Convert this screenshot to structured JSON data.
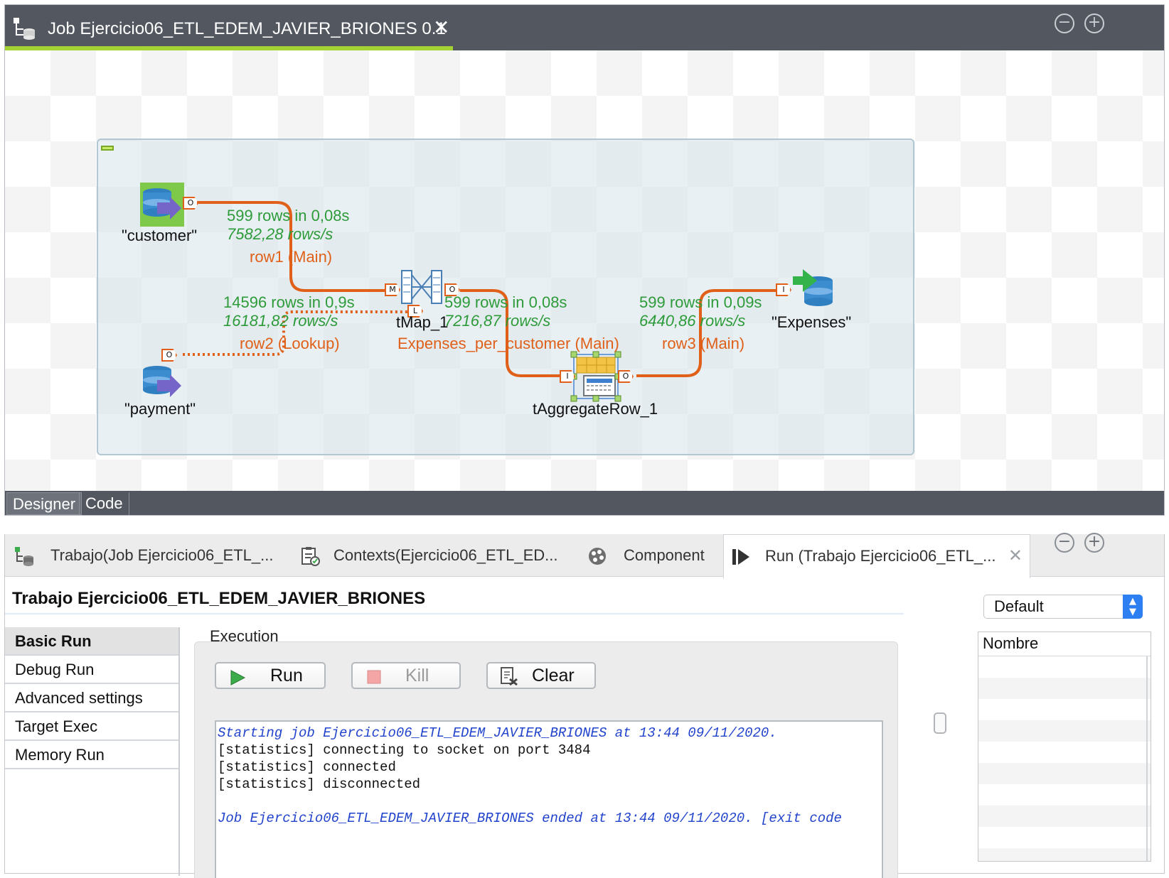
{
  "editor": {
    "tab_title": "Job Ejercicio06_ETL_EDEM_JAVIER_BRIONES 0.1",
    "tab_close": "✕",
    "minimize": "−",
    "maximize": "+",
    "bottom_tabs": [
      "Designer",
      "Code"
    ]
  },
  "components": {
    "customer": "\"customer\"",
    "payment": "\"payment\"",
    "tmap": "tMap_1",
    "aggregate": "tAggregateRow_1",
    "expenses": "\"Expenses\""
  },
  "ports": {
    "customer_out": "O",
    "payment_out": "O",
    "tmap_main_in": "M",
    "tmap_lookup_in": "L",
    "tmap_out": "O",
    "agg_in": "I",
    "agg_out": "O",
    "expenses_in": "I"
  },
  "flows": {
    "row1": {
      "rows": "599 rows in 0,08s",
      "rate": "7582,28 rows/s",
      "name": "row1 (Main)"
    },
    "row2": {
      "rows": "14596 rows in 0,9s",
      "rate": "16181,82 rows/s",
      "name": "row2 (Lookup)"
    },
    "expenses_per_customer": {
      "rows": "599 rows in 0,08s",
      "rate": "7216,87 rows/s",
      "name": "Expenses_per_customer (Main)"
    },
    "row3": {
      "rows": "599 rows in 0,09s",
      "rate": "6440,86 rows/s",
      "name": "row3 (Main)"
    }
  },
  "view": {
    "tabs": [
      {
        "label": "Trabajo(Job Ejercicio06_ETL_...",
        "icon": "job-icon"
      },
      {
        "label": "Contexts(Ejercicio06_ETL_ED...",
        "icon": "contexts-icon"
      },
      {
        "label": "Component",
        "icon": "component-icon"
      },
      {
        "label": "Run (Trabajo Ejercicio06_ETL_...",
        "icon": "run-icon",
        "active": true
      }
    ],
    "title": "Trabajo Ejercicio06_ETL_EDEM_JAVIER_BRIONES",
    "side_menu": [
      "Basic Run",
      "Debug Run",
      "Advanced settings",
      "Target Exec",
      "Memory Run"
    ],
    "execution_label": "Execution",
    "buttons": {
      "run": "Run",
      "kill": "Kill",
      "clear": "Clear"
    },
    "console": [
      {
        "text": "Starting job Ejercicio06_ETL_EDEM_JAVIER_BRIONES at 13:44 09/11/2020.",
        "style": "info"
      },
      {
        "text": "[statistics] connecting to socket on port 3484",
        "style": "plain"
      },
      {
        "text": "[statistics] connected",
        "style": "plain"
      },
      {
        "text": "[statistics] disconnected",
        "style": "plain"
      },
      {
        "text": "",
        "style": "plain"
      },
      {
        "text": "Job Ejercicio06_ETL_EDEM_JAVIER_BRIONES ended at 13:44 09/11/2020. [exit code",
        "style": "info"
      }
    ],
    "context_select": "Default",
    "table_header": "Nombre"
  },
  "colors": {
    "flow_main": "#e0601a",
    "stats_green": "#2e9b3a",
    "tab_accent": "#a4d233",
    "tabbar_dark": "#53575f"
  }
}
